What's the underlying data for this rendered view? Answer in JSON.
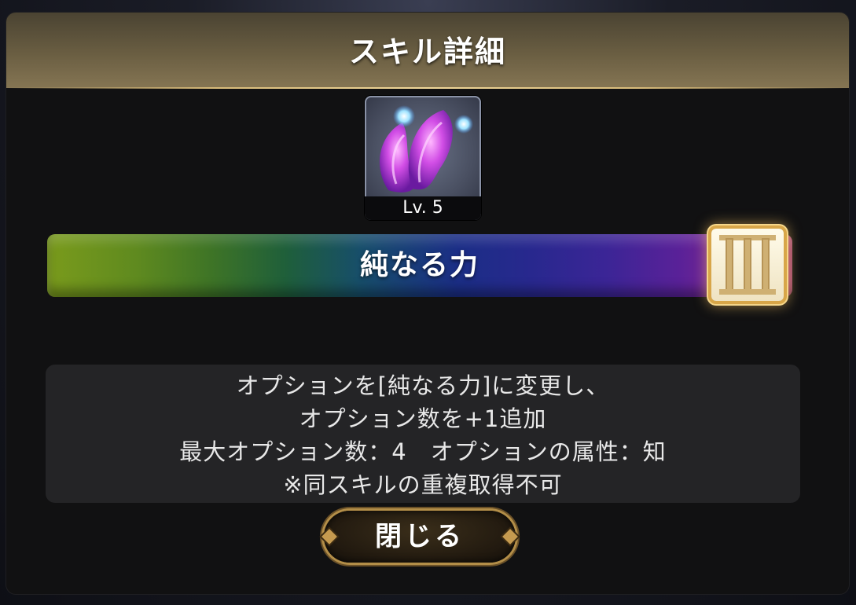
{
  "dialog": {
    "title": "スキル詳細",
    "skill": {
      "icon": "purple-fox-tail-icon",
      "level_label": "Lv. 5",
      "name": "純なる力",
      "rank_icon": "roman-numeral-three-badge-icon"
    },
    "description": [
      "オプションを[純なる力]に変更し、",
      "オプション数を+1追加",
      "最大オプション数：4　オプションの属性：知",
      "※同スキルの重複取得不可"
    ],
    "close_label": "閉じる"
  }
}
